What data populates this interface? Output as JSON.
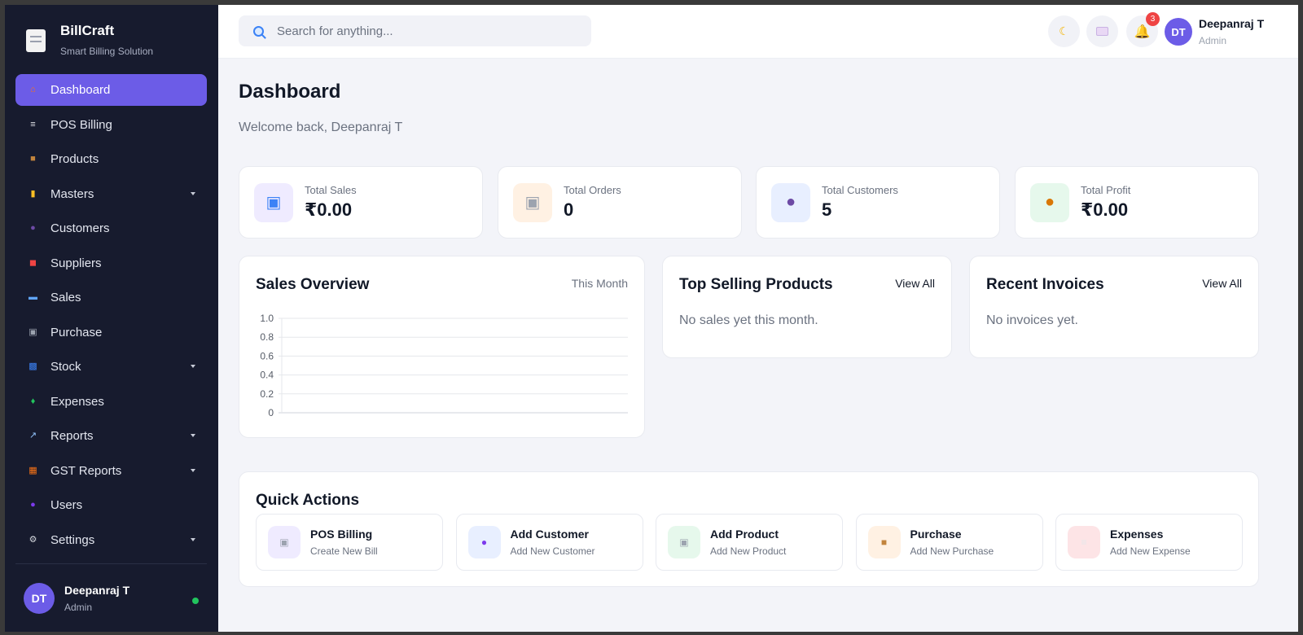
{
  "brand": {
    "name": "BillCraft",
    "tagline": "Smart Billing Solution",
    "icon": "receipt-icon"
  },
  "sidebar": {
    "items": [
      {
        "label": "Dashboard",
        "icon": "home-icon",
        "active": true,
        "has_submenu": false
      },
      {
        "label": "POS Billing",
        "icon": "receipt-icon",
        "has_submenu": false
      },
      {
        "label": "Products",
        "icon": "box-icon",
        "has_submenu": false
      },
      {
        "label": "Masters",
        "icon": "folder-icon",
        "has_submenu": true
      },
      {
        "label": "Customers",
        "icon": "users-icon",
        "has_submenu": false
      },
      {
        "label": "Suppliers",
        "icon": "truck-icon",
        "has_submenu": false
      },
      {
        "label": "Sales",
        "icon": "card-icon",
        "has_submenu": false
      },
      {
        "label": "Purchase",
        "icon": "cart-icon",
        "has_submenu": false
      },
      {
        "label": "Stock",
        "icon": "bar-chart-icon",
        "has_submenu": true
      },
      {
        "label": "Expenses",
        "icon": "money-wings-icon",
        "has_submenu": false
      },
      {
        "label": "Reports",
        "icon": "trend-icon",
        "has_submenu": true
      },
      {
        "label": "GST Reports",
        "icon": "abacus-icon",
        "has_submenu": true
      },
      {
        "label": "Users",
        "icon": "user-icon",
        "has_submenu": false
      },
      {
        "label": "Settings",
        "icon": "gear-icon",
        "has_submenu": true
      }
    ],
    "footer": {
      "initials": "DT",
      "name": "Deepanraj T",
      "role": "Admin",
      "status_color": "#22c55e"
    }
  },
  "topbar": {
    "search_placeholder": "Search for anything...",
    "notification_count": "3",
    "user": {
      "initials": "DT",
      "name": "Deepanraj T",
      "role": "Admin"
    }
  },
  "page": {
    "title": "Dashboard",
    "subtitle": "Welcome back, Deepanraj T"
  },
  "stats": [
    {
      "label": "Total Sales",
      "value": "₹0.00",
      "icon": "shopping-bag-icon",
      "bg": "#efebff"
    },
    {
      "label": "Total Orders",
      "value": "0",
      "icon": "cart-icon",
      "bg": "#fff1e3"
    },
    {
      "label": "Total Customers",
      "value": "5",
      "icon": "users-icon",
      "bg": "#e8efff"
    },
    {
      "label": "Total Profit",
      "value": "₹0.00",
      "icon": "money-bag-icon",
      "bg": "#e6f8ec"
    }
  ],
  "sales_overview": {
    "title": "Sales Overview",
    "period": "This Month"
  },
  "top_selling": {
    "title": "Top Selling Products",
    "link": "View All",
    "empty": "No sales yet this month."
  },
  "recent_invoices": {
    "title": "Recent Invoices",
    "link": "View All",
    "empty": "No invoices yet."
  },
  "quick_actions": {
    "title": "Quick Actions",
    "items": [
      {
        "label": "POS Billing",
        "sub": "Create New Bill",
        "icon": "cart-icon",
        "bg": "#efebff"
      },
      {
        "label": "Add Customer",
        "sub": "Add New Customer",
        "icon": "user-icon",
        "bg": "#e8efff"
      },
      {
        "label": "Add Product",
        "sub": "Add New Product",
        "icon": "cart-icon",
        "bg": "#e6f8ec"
      },
      {
        "label": "Purchase",
        "sub": "Add New Purchase",
        "icon": "box-icon",
        "bg": "#fff1e3"
      },
      {
        "label": "Expenses",
        "sub": "Add New Expense",
        "icon": "receipt-icon",
        "bg": "#fde4e6"
      }
    ]
  },
  "colors": {
    "accent": "#6c5ce7",
    "sidebar_bg": "#171b2e",
    "page_bg": "#f3f4f9",
    "badge": "#ef4444"
  },
  "chart_data": {
    "type": "line",
    "title": "Sales Overview",
    "x": [],
    "series": [],
    "ylim": [
      0,
      1.0
    ],
    "yticks": [
      "0",
      "0.2",
      "0.4",
      "0.6",
      "0.8",
      "1.0"
    ],
    "grid": true
  }
}
